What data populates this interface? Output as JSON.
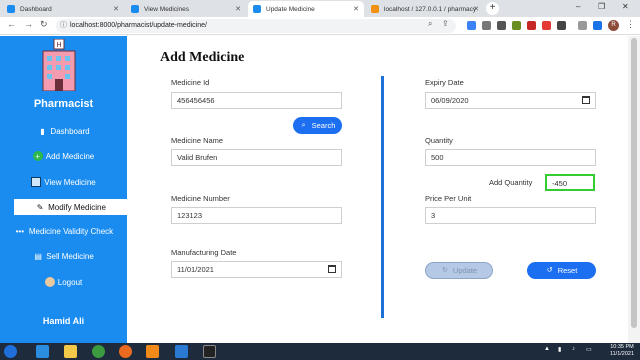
{
  "browser": {
    "tabs": [
      {
        "label": "Dashboard",
        "fav_color": "#1a8cf0"
      },
      {
        "label": "View Medicines",
        "fav_color": "#1a8cf0"
      },
      {
        "label": "Update Medicine",
        "fav_color": "#1a8cf0"
      },
      {
        "label": "localhost / 127.0.0.1 / pharmacy",
        "fav_color": "#f29111"
      }
    ],
    "url": "localhost:8000/pharmacist/update-medicine/",
    "profile_initial": "R"
  },
  "sidebar": {
    "brand": "Pharmacist",
    "items": [
      {
        "label": "Dashboard",
        "icon": "dashboard-icon"
      },
      {
        "label": "Add Medicine",
        "icon": "plus-circle-icon"
      },
      {
        "label": "View Medicine",
        "icon": "monitor-icon"
      },
      {
        "label": "Modify Medicine",
        "icon": "edit-icon",
        "active": true
      },
      {
        "label": "Medicine Validity Check",
        "icon": "dots-icon"
      },
      {
        "label": "Sell Medicine",
        "icon": "cart-icon"
      },
      {
        "label": "Logout",
        "icon": "avatar-icon"
      }
    ],
    "user": "Hamid Ali"
  },
  "form": {
    "title": "Add Medicine",
    "medicine_id": {
      "label": "Medicine Id",
      "value": "456456456"
    },
    "search_label": "Search",
    "medicine_name": {
      "label": "Medicine Name",
      "value": "Valid Brufen"
    },
    "medicine_number": {
      "label": "Medicine Number",
      "value": "123123"
    },
    "manufacturing_date": {
      "label": "Manufacturing Date",
      "value": "11/01/2021"
    },
    "expiry_date": {
      "label": "Expiry Date",
      "value": "06/09/2020"
    },
    "quantity": {
      "label": "Quantity",
      "value": "500"
    },
    "add_quantity": {
      "label": "Add Quantity",
      "value": "-450"
    },
    "price_per_unit": {
      "label": "Price Per Unit",
      "value": "3"
    },
    "update_label": "Update",
    "reset_label": "Reset"
  },
  "taskbar": {
    "time": "10:35 PM",
    "date": "11/1/2021"
  },
  "colors": {
    "sidebar": "#1a8cf0",
    "button": "#1c6ff0",
    "divider": "#1c70d8",
    "highlight": "#33cc33"
  }
}
